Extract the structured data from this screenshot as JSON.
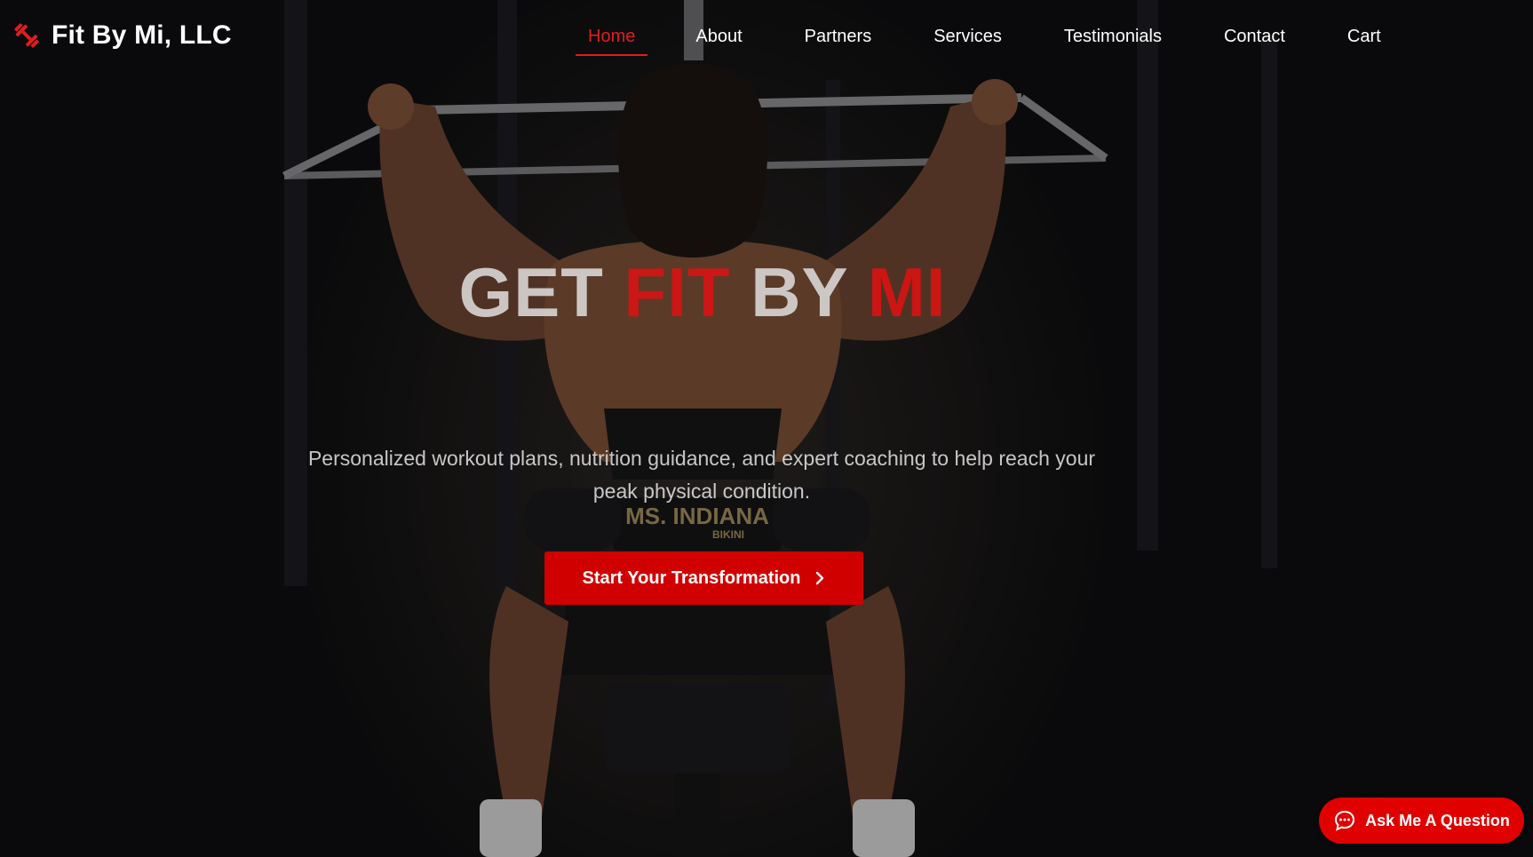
{
  "brand": {
    "name": "Fit By Mi, LLC",
    "icon": "dumbbell-icon",
    "accent": "#e11d1d"
  },
  "nav": {
    "items": [
      {
        "label": "Home",
        "active": true
      },
      {
        "label": "About"
      },
      {
        "label": "Partners"
      },
      {
        "label": "Services"
      },
      {
        "label": "Testimonials"
      },
      {
        "label": "Contact"
      },
      {
        "label": "Cart"
      }
    ]
  },
  "hero": {
    "headline": {
      "w1": "GET",
      "r1": "FIT",
      "w2": "BY",
      "r2": "MI"
    },
    "subtitle": "Personalized workout plans, nutrition guidance, and expert coaching to help reach your peak physical condition.",
    "cta_label": "Start Your Transformation",
    "cta_icon": "chevron-right-icon",
    "background_image": "athlete performing lat pulldown in gym",
    "belt_text": {
      "line1": "MS. INDIANA",
      "line2": "BIKINI"
    }
  },
  "chat": {
    "label": "Ask Me A Question",
    "icon": "chat-bubble-icon"
  },
  "colors": {
    "accent": "#d00000",
    "bg": "#0b0b0d"
  }
}
